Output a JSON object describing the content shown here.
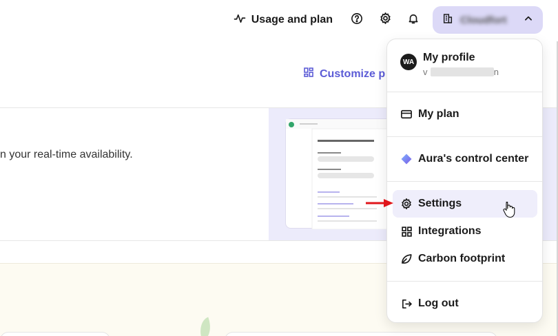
{
  "topbar": {
    "usage_label": "Usage and plan",
    "account_name": "Cloudfort"
  },
  "page": {
    "customize_label": "Customize p",
    "availability_text": "n your real-time availability."
  },
  "menu": {
    "profile": {
      "avatar_initials": "WA",
      "title": "My profile",
      "email_fragment_start": "v",
      "email_fragment_end": "n"
    },
    "items": [
      {
        "label": "My plan",
        "icon": "card-icon"
      },
      {
        "label": "Aura's control center",
        "icon": "diamond-icon"
      },
      {
        "label": "Settings",
        "icon": "gear-icon",
        "active": true
      },
      {
        "label": "Integrations",
        "icon": "grid-icon"
      },
      {
        "label": "Carbon footprint",
        "icon": "leaf-icon"
      },
      {
        "label": "Log out",
        "icon": "logout-icon"
      }
    ]
  },
  "colors": {
    "accent": "#5b5bd6",
    "account_button_bg": "#dcd9f7",
    "active_item_bg": "#efeefb",
    "annotation_arrow": "#e0161b"
  }
}
